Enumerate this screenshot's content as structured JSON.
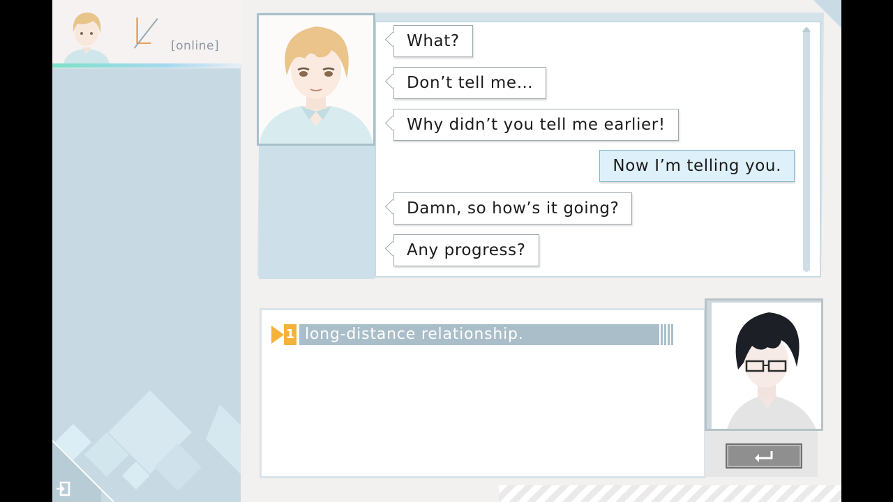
{
  "contact": {
    "initial": "L",
    "status": "[online]"
  },
  "chat": {
    "messages": [
      {
        "sender": "them",
        "text": "What?"
      },
      {
        "sender": "them",
        "text": "Don’t tell me…"
      },
      {
        "sender": "them",
        "text": "Why didn’t you tell me earlier!"
      },
      {
        "sender": "me",
        "text": "Now I’m telling you."
      },
      {
        "sender": "them",
        "text": "Damn, so how’s it going?"
      },
      {
        "sender": "them",
        "text": "Any progress?"
      }
    ]
  },
  "choice": {
    "number": "1",
    "text": "long-distance relationship."
  },
  "colors": {
    "accent": "#f5b23a",
    "panel": "#c7d9e2",
    "bubble_me": "#def0f9"
  },
  "icons": {
    "exit": "exit-icon",
    "enter": "enter-return-icon"
  }
}
